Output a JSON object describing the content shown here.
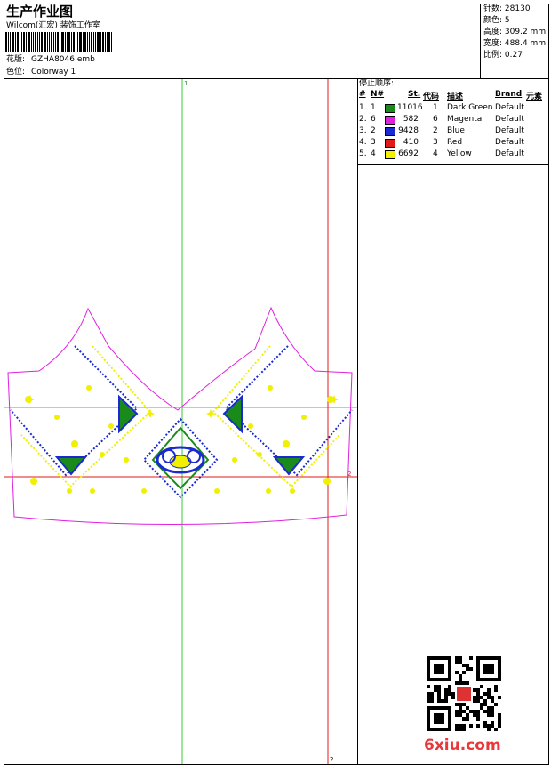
{
  "header": {
    "title": "生产作业图",
    "company": "Wilcom(汇宏) 装饰工作室",
    "design_label": "花版:",
    "design_file": "GZHA8046.emb",
    "colorway_label": "色位:",
    "colorway_value": "Colorway 1"
  },
  "stats": [
    {
      "label": "针数:",
      "value": "28130"
    },
    {
      "label": "颜色:",
      "value": "5"
    },
    {
      "label": "高度:",
      "value": "309.2 mm"
    },
    {
      "label": "宽度:",
      "value": "488.4 mm"
    },
    {
      "label": "比例:",
      "value": "0.27"
    }
  ],
  "legend": {
    "title": "停止顺序:",
    "headers": {
      "hash": "#",
      "n": "N#",
      "st": "St.",
      "code": "代码",
      "desc": "描述",
      "brand": "Brand",
      "elem": "元素"
    },
    "rows": [
      {
        "hash": "1.",
        "n": "1",
        "st": "11016",
        "code": "1",
        "desc": "Dark Green",
        "brand": "Default",
        "color": "#1a8a1a"
      },
      {
        "hash": "2.",
        "n": "6",
        "st": "582",
        "code": "6",
        "desc": "Magenta",
        "brand": "Default",
        "color": "#e020e0"
      },
      {
        "hash": "3.",
        "n": "2",
        "st": "9428",
        "code": "2",
        "desc": "Blue",
        "brand": "Default",
        "color": "#1a2ad0"
      },
      {
        "hash": "4.",
        "n": "3",
        "st": "410",
        "code": "3",
        "desc": "Red",
        "brand": "Default",
        "color": "#e01a1a"
      },
      {
        "hash": "5.",
        "n": "4",
        "st": "6692",
        "code": "4",
        "desc": "Yellow",
        "brand": "Default",
        "color": "#f0f000"
      }
    ]
  },
  "canvas": {
    "guide_top_label": "1",
    "guide_bottom_label": "2",
    "guide_right_label": "2"
  },
  "watermark": {
    "text": "6xiu.com"
  }
}
